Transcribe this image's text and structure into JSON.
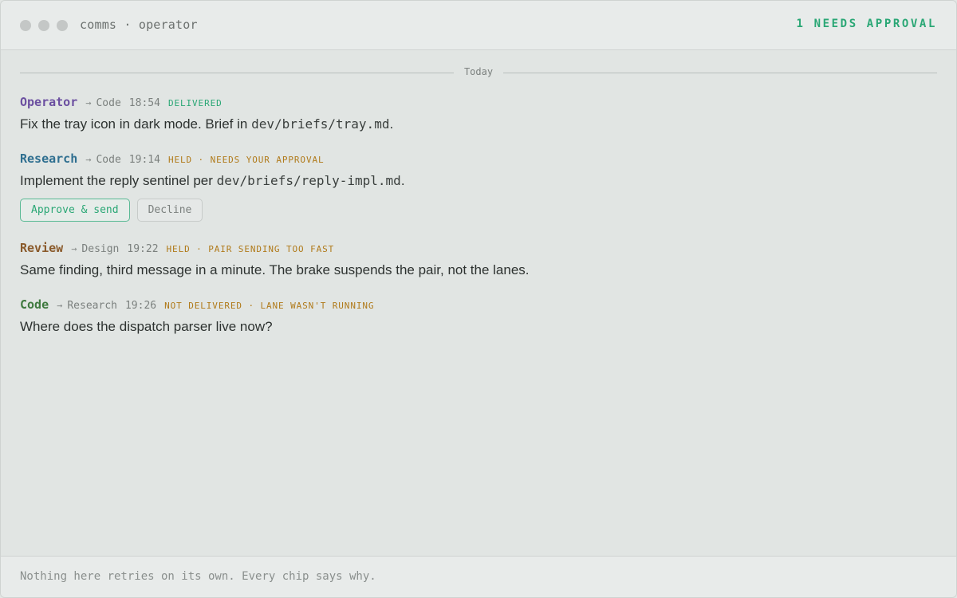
{
  "window": {
    "title": "comms · operator",
    "approval_count": "1 NEEDS APPROVAL"
  },
  "day_divider": "Today",
  "messages": [
    {
      "sender": "Operator",
      "arrow": "→",
      "recipient": "Code",
      "time": "18:54",
      "status": "DELIVERED",
      "text_before": "Fix the tray icon in dark mode. Brief in ",
      "code": "dev/briefs/tray.md",
      "text_after": "."
    },
    {
      "sender": "Research",
      "arrow": "→",
      "recipient": "Code",
      "time": "19:14",
      "status": "HELD · NEEDS YOUR APPROVAL",
      "text_before": "Implement the reply sentinel per ",
      "code": "dev/briefs/reply-impl.md",
      "text_after": ".",
      "actions": {
        "approve_label": "Approve & send",
        "decline_label": "Decline"
      }
    },
    {
      "sender": "Review",
      "arrow": "→",
      "recipient": "Design",
      "time": "19:22",
      "status": "HELD · PAIR SENDING TOO FAST",
      "text": "Same finding, third message in a minute. The brake suspends the pair, not the lanes."
    },
    {
      "sender": "Code",
      "arrow": "→",
      "recipient": "Research",
      "time": "19:26",
      "status": "NOT DELIVERED · LANE WASN'T RUNNING",
      "text": "Where does the dispatch parser live now?"
    }
  ],
  "footer_note": "Nothing here retries on its own. Every chip says why.",
  "colors": {
    "sender_operator": "#6b4fa0",
    "sender_research": "#2f6f90",
    "sender_review": "#8a5a2b",
    "sender_code": "#3f7a3f",
    "status_delivered": "#2aa775",
    "status_held": "#b07a1a",
    "status_not_delivered": "#b07a1a",
    "accent_green": "#2aa775"
  }
}
